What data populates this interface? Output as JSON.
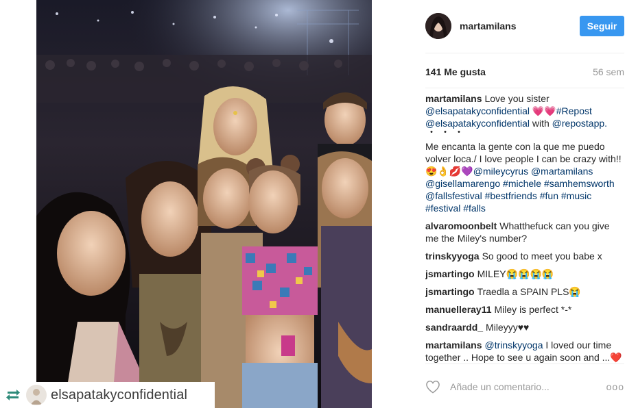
{
  "post": {
    "username": "martamilans",
    "follow_label": "Seguir",
    "likes": "141 Me gusta",
    "age": "56 sem",
    "photo_alt": "",
    "repost_username": "elsapatakyconfidential"
  },
  "caption": {
    "user": "martamilans",
    "line1_text": "Love you sister",
    "mention1": "@elsapatakyconfidential",
    "emoji1": "💗💗",
    "tag_repost": "#Repost",
    "mention2": "@elsapatakyconfidential",
    "with_text": "with",
    "mention3": "@repostapp.",
    "dots": "・・・",
    "para2": "Me encanta la gente con la que me puedo volver loca./ I love people I can be crazy with!!",
    "emoji2": "😍👌💋💜",
    "mention4": "@mileycyrus",
    "mention5": "@martamilans",
    "mention6": "@gisellamarengo",
    "tag1": "#michele",
    "tag2": "#samhemsworth",
    "mention7": "@fallsfestival",
    "tag3": "#bestfriends",
    "tag4": "#fun",
    "tag5": "#music",
    "tag6": "#festival",
    "tag7": "#falls"
  },
  "comments": [
    {
      "user": "alvaromoonbelt",
      "text": "Whatthefuck can you give me the Miley's number?"
    },
    {
      "user": "trinskyyoga",
      "text": "So good to meet you babe x"
    },
    {
      "user": "jsmartingo",
      "text": "MILEY😭😭😭😭"
    },
    {
      "user": "jsmartingo",
      "text": "Traedla a SPAIN PLS😭"
    },
    {
      "user": "manuelleray11",
      "text": "Miley is perfect *-*"
    },
    {
      "user": "sandraardd_",
      "text": "Mileyyy♥♥"
    },
    {
      "user": "martamilans",
      "mention": "@trinskyyoga",
      "text": "I loved our time together .. Hope to see u again soon and ...",
      "emoji": "❤️❤️"
    }
  ],
  "add_comment": {
    "placeholder": "Añade un comentario...",
    "more_label": "ooo"
  },
  "icons": {
    "repost": "repost-icon",
    "heart": "heart-outline-icon",
    "more": "more-options-icon"
  },
  "colors": {
    "follow_button": "#3897f0",
    "link": "#003569",
    "muted": "#999999",
    "text": "#262626"
  }
}
